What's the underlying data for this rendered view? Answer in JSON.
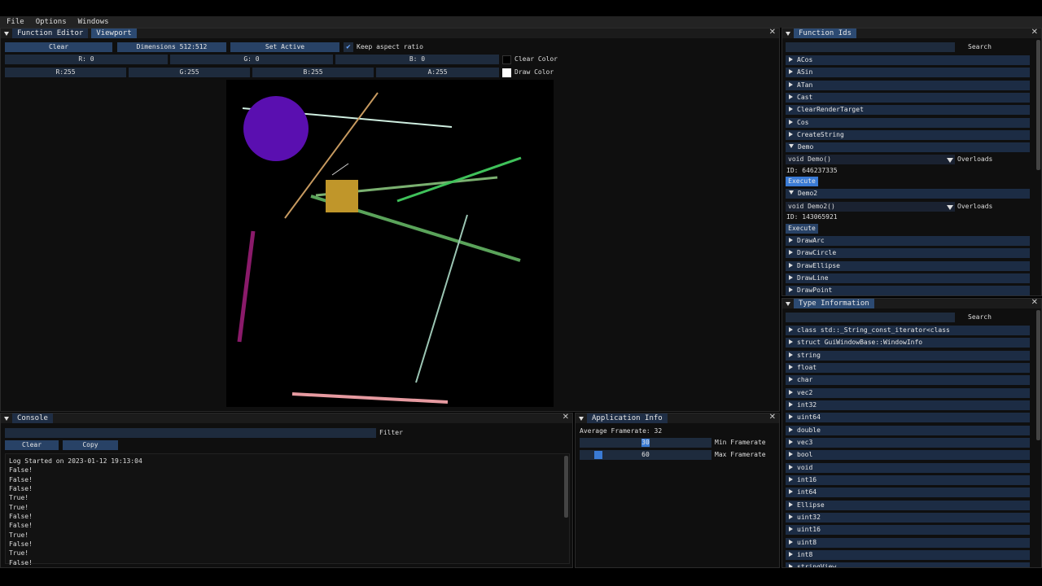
{
  "menu": {
    "items": [
      "File",
      "Options",
      "Windows"
    ]
  },
  "editor": {
    "tabs": [
      "Function Editor",
      "Viewport"
    ],
    "buttons": {
      "clear": "Clear",
      "dimensions": "Dimensions 512:512",
      "set_active": "Set Active"
    },
    "keep_aspect": {
      "label": "Keep aspect ratio",
      "checked": true
    },
    "clear_color": {
      "r": "R:  0",
      "g": "G:  0",
      "b": "B:  0",
      "label": "Clear Color",
      "swatch": "#000000"
    },
    "draw_color": {
      "r": "R:255",
      "g": "G:255",
      "b": "B:255",
      "a": "A:255",
      "label": "Draw Color",
      "swatch": "#ffffff"
    }
  },
  "canvas": {
    "background": "#000000",
    "shapes": [
      {
        "kind": "circle",
        "color": "#5a0fb0"
      },
      {
        "kind": "square",
        "color": "#c0962a"
      },
      {
        "kind": "line",
        "color": "#cfeee0",
        "name": "white-line"
      },
      {
        "kind": "line",
        "color": "#c79a60",
        "name": "tan-line"
      },
      {
        "kind": "line",
        "color": "#5aa35a",
        "name": "green-line-long"
      },
      {
        "kind": "line",
        "color": "#7ab070",
        "name": "olive-line"
      },
      {
        "kind": "line",
        "color": "#3fc15a",
        "name": "bright-green-line"
      },
      {
        "kind": "line",
        "color": "#8a1a6a",
        "name": "magenta-line"
      },
      {
        "kind": "line",
        "color": "#9cc6b4",
        "name": "pale-line"
      },
      {
        "kind": "line",
        "color": "#e69aa0",
        "name": "pink-line"
      },
      {
        "kind": "line",
        "color": "#d6d6d6",
        "name": "small-line"
      }
    ]
  },
  "function_ids": {
    "title": "Function Ids",
    "search_label": "Search",
    "items": [
      "ACos",
      "ASin",
      "ATan",
      "Cast",
      "ClearRenderTarget",
      "Cos",
      "CreateString",
      "Demo",
      "Demo2",
      "DrawArc",
      "DrawCircle",
      "DrawEllipse",
      "DrawLine",
      "DrawPoint"
    ],
    "demo": {
      "signature": "void Demo()",
      "overloads": "Overloads",
      "id": "ID: 646237335",
      "execute": "Execute"
    },
    "demo2": {
      "signature": "void Demo2()",
      "overloads": "Overloads",
      "id": "ID: 143065921",
      "execute": "Execute"
    }
  },
  "type_info": {
    "title": "Type Information",
    "search_label": "Search",
    "items": [
      "class std::_String_const_iterator<class std::_String_val<stru",
      "struct GuiWindowBase::WindowInfo",
      "string",
      "float",
      "char",
      "vec2",
      "int32",
      "uint64",
      "double",
      "vec3",
      "bool",
      "void",
      "int16",
      "int64",
      "Ellipse",
      "uint32",
      "uint16",
      "uint8",
      "int8",
      "stringView"
    ]
  },
  "console": {
    "title": "Console",
    "filter_label": "Filter",
    "clear": "Clear",
    "copy": "Copy",
    "lines": [
      "Log Started on 2023-01-12 19:13:04",
      "False!",
      "False!",
      "False!",
      "True!",
      "True!",
      "False!",
      "False!",
      "True!",
      "False!",
      "True!",
      "False!"
    ]
  },
  "app_info": {
    "title": "Application Info",
    "avg_framerate": "Average Framerate: 32",
    "min_framerate": {
      "value": "30",
      "label": "Min Framerate",
      "fraction": 0.25
    },
    "max_framerate": {
      "value": "60",
      "label": "Max Framerate",
      "fraction": 0.1
    }
  },
  "colors": {
    "accent": "#2c4a72",
    "button": "#284266",
    "item": "#1c2c44",
    "highlight": "#3a7bd5"
  }
}
